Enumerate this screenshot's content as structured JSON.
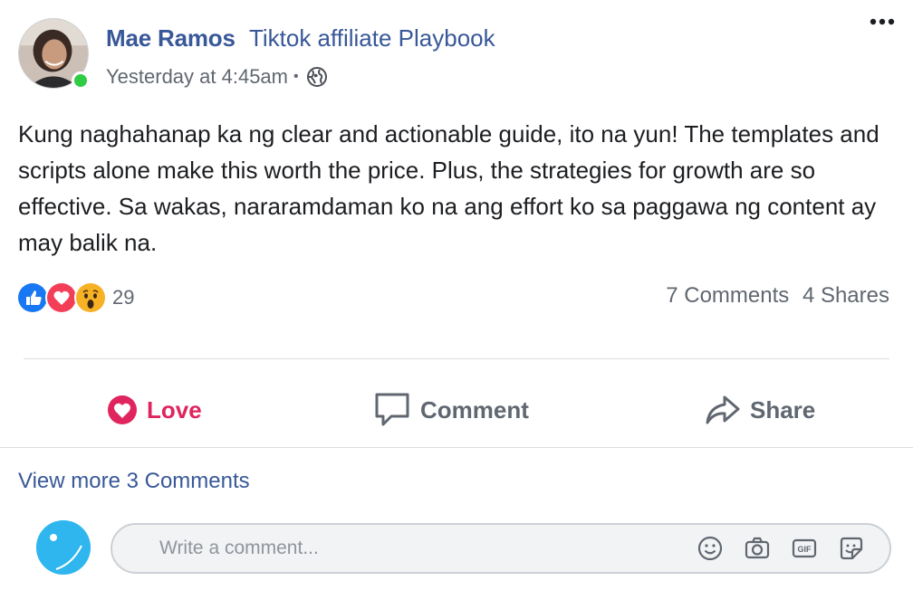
{
  "post": {
    "author": "Mae Ramos",
    "group": "Tiktok affiliate Playbook",
    "timestamp": "Yesterday at 4:45am",
    "meta_separator": "•",
    "privacy_icon": "globe-icon",
    "text": "Kung naghahanap ka ng clear and actionable guide, ito na yun! The templates and scripts alone make this worth the price. Plus, the strategies for growth are so effective. Sa wakas, nararamdaman ko na ang effort ko sa paggawa ng content ay may balik na.",
    "online": true
  },
  "reactions": {
    "types": [
      "like",
      "love",
      "wow"
    ],
    "count": "29"
  },
  "stats": {
    "comments": "7 Comments",
    "shares": "4 Shares"
  },
  "actions": {
    "love_label": "Love",
    "comment_label": "Comment",
    "share_label": "Share"
  },
  "comments": {
    "view_more": "View more 3 Comments"
  },
  "composer": {
    "placeholder": "Write a comment...",
    "tools": [
      "emoji-icon",
      "camera-icon",
      "gif-icon",
      "sticker-icon"
    ]
  },
  "colors": {
    "link_blue": "#385898",
    "love_red": "#e0245e",
    "online_green": "#31cc46",
    "like_blue": "#1877f2",
    "wow_yellow": "#f7b125"
  }
}
